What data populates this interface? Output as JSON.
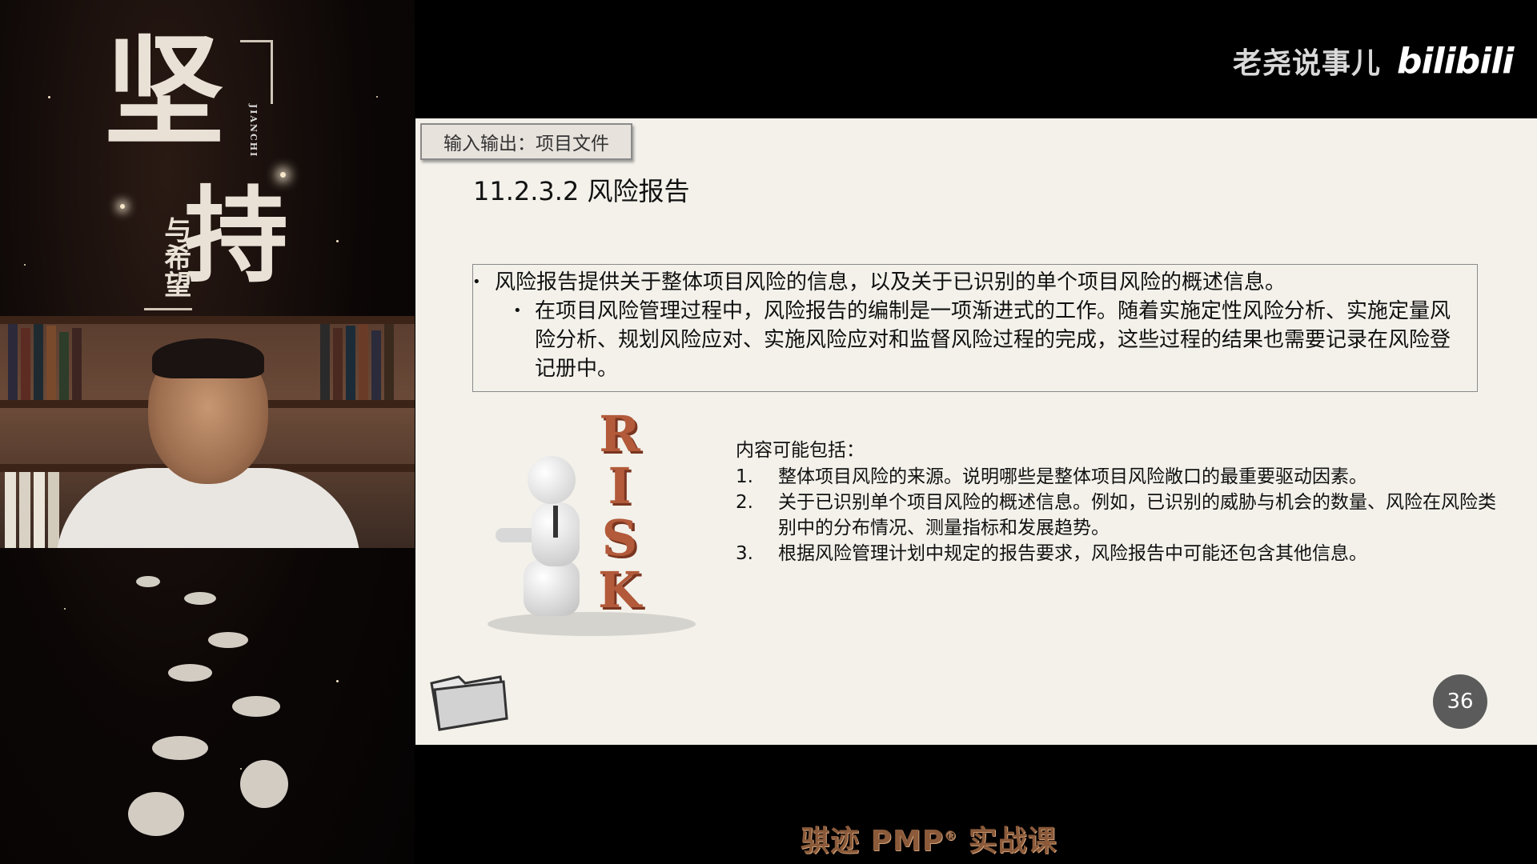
{
  "poster": {
    "char_1": "坚",
    "char_2": "持",
    "subtitle": "与希望",
    "pinyin": "JIANCHI"
  },
  "channel": {
    "name": "老尧说事儿",
    "logo": "bilibili"
  },
  "slide": {
    "tab_label": "输入输出：项目文件",
    "heading": "11.2.3.2 风险报告",
    "bullet_main": "风险报告提供关于整体项目风险的信息，以及关于已识别的单个项目风险的概述信息。",
    "bullet_sub": "在项目风险管理过程中，风险报告的编制是一项渐进式的工作。随着实施定性风险分析、实施定量风险分析、规划风险应对、实施风险应对和监督风险过程的完成，这些过程的结果也需要记录在风险登记册中。",
    "risk_letters": [
      "R",
      "I",
      "S",
      "K"
    ],
    "content_intro": "内容可能包括：",
    "content_items": [
      {
        "num": "1.",
        "text": "整体项目风险的来源。说明哪些是整体项目风险敞口的最重要驱动因素。"
      },
      {
        "num": "2.",
        "text": "关于已识别单个项目风险的概述信息。例如，已识别的威胁与机会的数量、风险在风险类别中的分布情况、测量指标和发展趋势。"
      },
      {
        "num": "3.",
        "text": "根据风险管理计划中规定的报告要求，风险报告中可能还包含其他信息。"
      }
    ],
    "page_number": "36"
  },
  "footer": {
    "brand_pre": "骐迹 PMP",
    "brand_reg": "®",
    "brand_post": " 实战课"
  },
  "icons": {
    "folder": "folder-icon",
    "bullet": "bullet-dot-icon"
  },
  "colors": {
    "slide_bg": "#f3f1ea",
    "risk_letters": "#b25a3a",
    "page_badge": "#5b5b5b",
    "footer_brand": "#8a5a3a"
  }
}
